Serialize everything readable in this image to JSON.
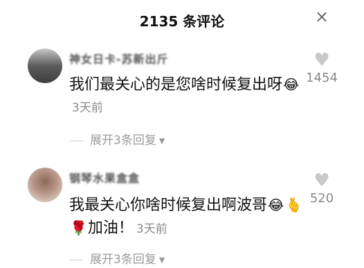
{
  "header": {
    "title": "2135 条评论",
    "close_glyph": "×"
  },
  "comments": [
    {
      "username": "神女日卡-苏新出斤",
      "text": "我们最关心的是您啥时候复出呀",
      "emojis": [
        "😂"
      ],
      "time": "3天前",
      "likes": "1454",
      "expand_label": "展开3条回复"
    },
    {
      "username": "钢琴水果盒盒",
      "text_before": "我最关心你啥时候复出啊波哥",
      "emojis": [
        "😂",
        "🫰",
        "🌹"
      ],
      "text_after": "加油！",
      "time": "3天前",
      "likes": "520",
      "expand_label": "展开3条回复"
    }
  ],
  "icons": {
    "heart": "heart-icon",
    "close": "close-icon",
    "expand_arrow": "caret-down-icon"
  },
  "colors": {
    "background": "#ffffff",
    "text": "#111111",
    "secondary": "#8a8a8a"
  }
}
